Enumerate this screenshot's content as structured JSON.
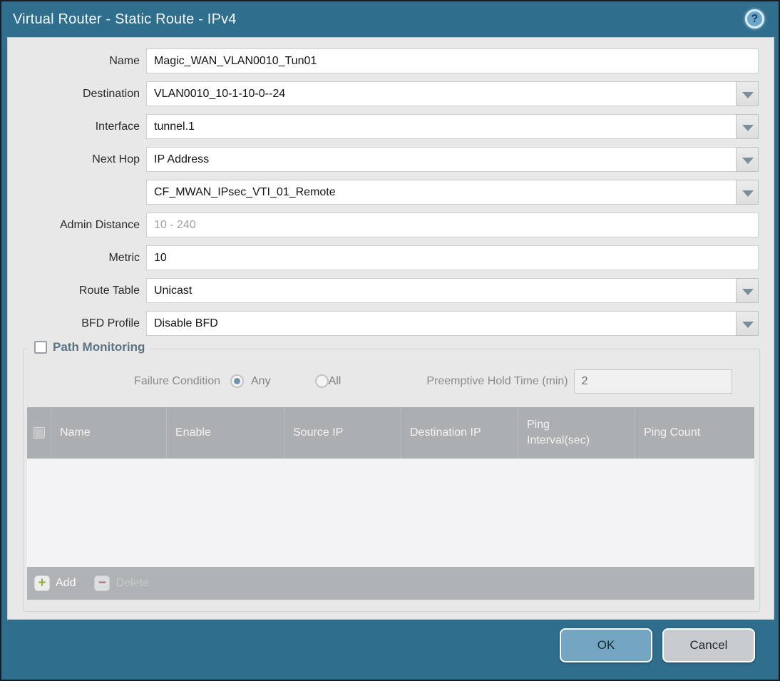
{
  "window": {
    "title": "Virtual Router - Static Route - IPv4",
    "help_icon": "?"
  },
  "form": {
    "fields": [
      {
        "label": "Name",
        "value": "Magic_WAN_VLAN0010_Tun01",
        "type": "text"
      },
      {
        "label": "Destination",
        "value": "VLAN0010_10-1-10-0--24",
        "type": "dropdown"
      },
      {
        "label": "Interface",
        "value": "tunnel.1",
        "type": "dropdown"
      },
      {
        "label": "Next Hop",
        "value": "IP Address",
        "type": "dropdown"
      },
      {
        "label": "",
        "value": "CF_MWAN_IPsec_VTI_01_Remote",
        "type": "dropdown"
      },
      {
        "label": "Admin Distance",
        "value": "",
        "placeholder": "10 - 240",
        "type": "text"
      },
      {
        "label": "Metric",
        "value": "10",
        "type": "text"
      },
      {
        "label": "Route Table",
        "value": "Unicast",
        "type": "dropdown"
      },
      {
        "label": "BFD Profile",
        "value": "Disable BFD",
        "type": "dropdown"
      }
    ]
  },
  "path_monitoring": {
    "legend": "Path Monitoring",
    "checked": false,
    "failure_condition_label": "Failure Condition",
    "option_any": "Any",
    "option_all": "All",
    "selected_option": "Any",
    "preemptive_label": "Preemptive Hold Time (min)",
    "preemptive_value": "2",
    "table": {
      "columns": [
        "Name",
        "Enable",
        "Source IP",
        "Destination IP",
        "Ping Interval(sec)",
        "Ping Count"
      ],
      "rows": []
    },
    "add_label": "Add",
    "delete_label": "Delete"
  },
  "footer": {
    "ok_label": "OK",
    "cancel_label": "Cancel"
  },
  "colors": {
    "titlebar": "#2f6e8d",
    "content_bg": "#e8e8e9",
    "table_header_bg": "#acafb1",
    "ok_button": "#73a6c0",
    "cancel_button": "#c9ccce",
    "add_icon_green": "#90ad3c",
    "delete_icon_red": "#9e5a5e",
    "legend_text": "#5b7485"
  }
}
